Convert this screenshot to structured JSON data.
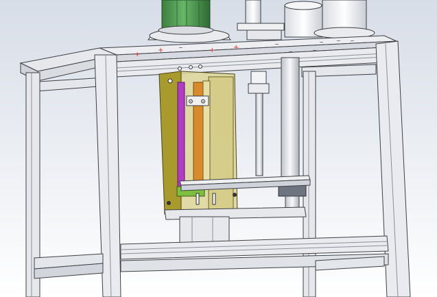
{
  "viewport": {
    "background_top": "#d7dde7",
    "background_bottom": "#ffffff"
  },
  "colors": {
    "frame_face": "#e9ebee",
    "frame_edge": "#3c3f44",
    "frame_shadow": "#b9bec6",
    "motor_green": "#4f9a52",
    "motor_green_dark": "#2f6a33",
    "cylinder_white": "#f4f5f7",
    "enclosure_olive": "#a89a2c",
    "enclosure_olive_light": "#cfc47a",
    "enclosure_glass": "#e2dba0",
    "rod_magenta": "#b33cc7",
    "rod_orange": "#d98a2a",
    "fastener_green": "#7fbf3f",
    "sensor_gray": "#6f7580",
    "mark_red": "#d62b2b"
  },
  "icons": {
    "motor": "motor-icon",
    "pneumatic_cylinder": "cylinder-icon",
    "linear_rod": "rod-icon",
    "bolt": "bolt-icon",
    "plus_mark": "plus-mark-icon"
  },
  "marks": {
    "plus_symbol": "+",
    "minus_symbol": "−"
  }
}
